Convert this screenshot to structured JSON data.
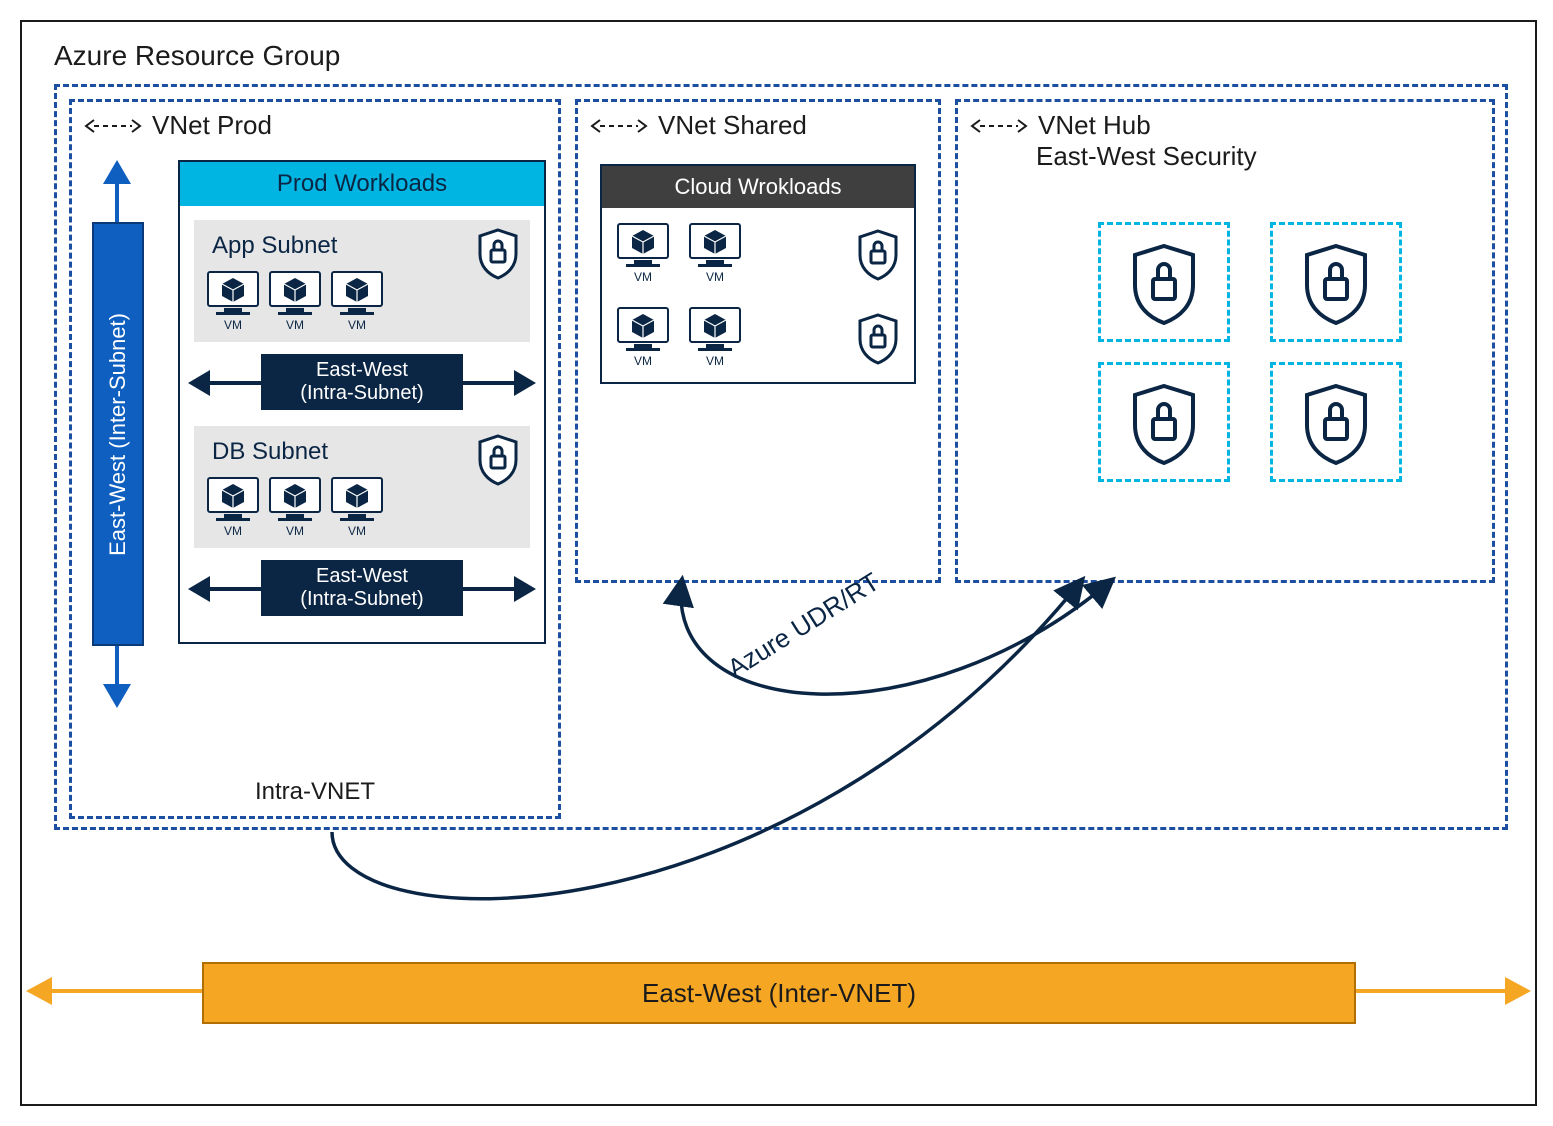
{
  "title": "Azure Resource Group",
  "vnet_prod": {
    "label": "VNet Prod",
    "inter_subnet_label": "East-West (Inter-Subnet)",
    "workloads_header": "Prod Workloads",
    "app_subnet": {
      "title": "App Subnet",
      "vm_label": "VM"
    },
    "intra_subnet_label": "East-West\n(Intra-Subnet)",
    "db_subnet": {
      "title": "DB Subnet",
      "vm_label": "VM"
    },
    "intra_vnet_label": "Intra-VNET"
  },
  "vnet_shared": {
    "label": "VNet Shared",
    "workloads_header": "Cloud Wrokloads",
    "vm_label": "VM"
  },
  "vnet_hub": {
    "label": "VNet Hub",
    "subtitle": "East-West Security"
  },
  "udr_label": "Azure UDR/RT",
  "inter_vnet_label": "East-West (Inter-VNET)",
  "colors": {
    "accent_blue": "#1c4ea1",
    "dark_navy": "#0b2644",
    "cyan": "#00b5e2",
    "orange": "#f5a623"
  }
}
